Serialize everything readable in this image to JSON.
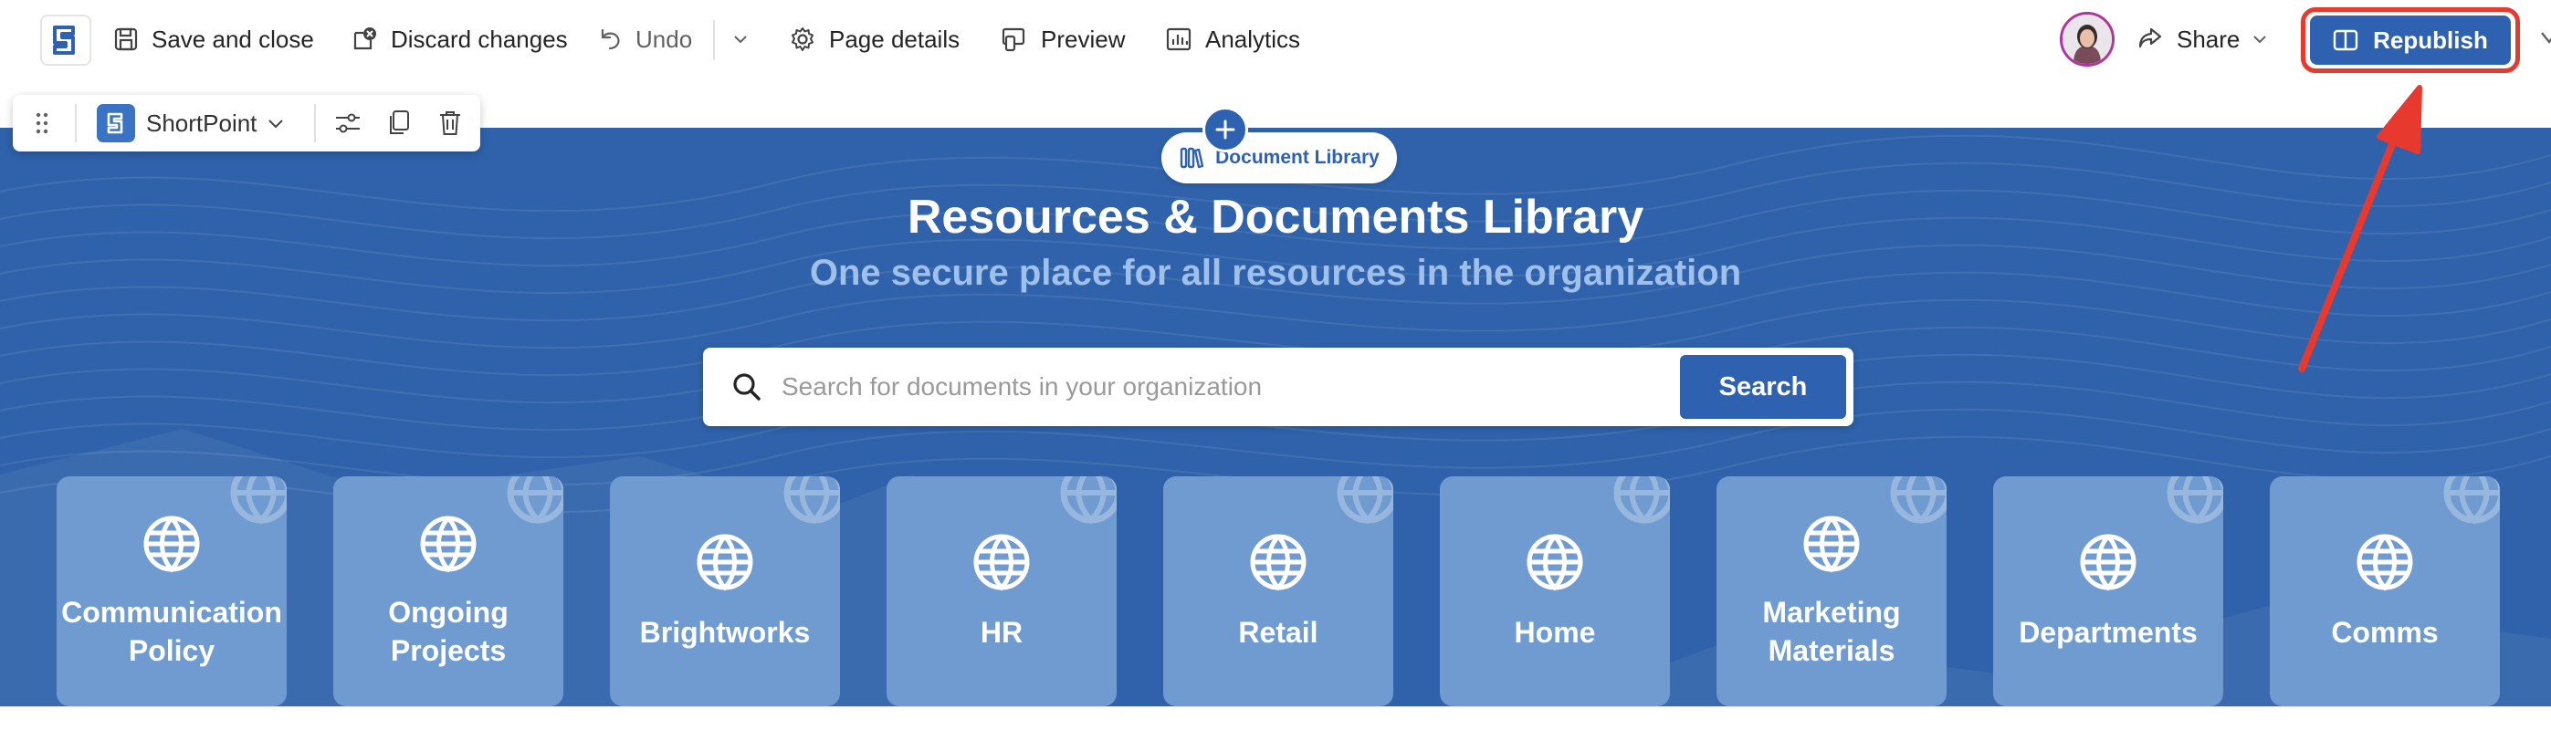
{
  "topbar": {
    "save_close": "Save and close",
    "discard": "Discard changes",
    "undo": "Undo",
    "page_details": "Page details",
    "preview": "Preview",
    "analytics": "Analytics",
    "share": "Share",
    "republish": "Republish"
  },
  "webpart_toolbar": {
    "name": "ShortPoint"
  },
  "hero": {
    "badge": "Document Library",
    "title": "Resources & Documents Library",
    "subtitle": "One secure place for all resources in the organization",
    "search_placeholder": "Search for documents in your organization",
    "search_button": "Search"
  },
  "tiles": [
    {
      "label": "Communication Policy"
    },
    {
      "label": "Ongoing Projects"
    },
    {
      "label": "Brightworks"
    },
    {
      "label": "HR"
    },
    {
      "label": "Retail"
    },
    {
      "label": "Home"
    },
    {
      "label": "Marketing Materials"
    },
    {
      "label": "Departments"
    },
    {
      "label": "Comms"
    }
  ],
  "colors": {
    "brand_blue": "#2e62b0",
    "hero_background": "#2f62aa",
    "tile_background": "#6f9bd1",
    "subtitle_text": "#9ec0ea",
    "highlight_red": "#e8392e"
  },
  "icons": {
    "app_logo": "shortpoint-logo-icon",
    "save": "save-disk-icon",
    "discard": "discard-icon",
    "undo": "undo-icon",
    "page_details": "gear-icon",
    "preview": "preview-devices-icon",
    "analytics": "chart-icon",
    "share": "share-icon",
    "republish": "book-open-icon",
    "tile": "globe-icon",
    "search": "search-icon"
  }
}
